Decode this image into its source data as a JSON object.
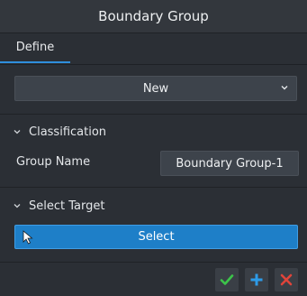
{
  "dialog": {
    "title": "Boundary Group"
  },
  "tabs": [
    {
      "label": "Define",
      "active": true
    }
  ],
  "mode_select": {
    "value": "New",
    "icon": "chevron-down-icon"
  },
  "classification": {
    "header": "Classification",
    "group_name_label": "Group Name",
    "group_name_value": "Boundary Group-1"
  },
  "select_target": {
    "header": "Select Target",
    "button_label": "Select",
    "cursor_icon": "cursor-arrow-icon"
  },
  "footer": {
    "ok_icon": "checkmark-icon",
    "apply_icon": "plus-icon",
    "cancel_icon": "close-icon"
  },
  "colors": {
    "accent": "#2f8fdc",
    "select_button": "#1e7fc8",
    "ok": "#3cc44a",
    "apply": "#2d9be8",
    "cancel": "#e0443a"
  }
}
